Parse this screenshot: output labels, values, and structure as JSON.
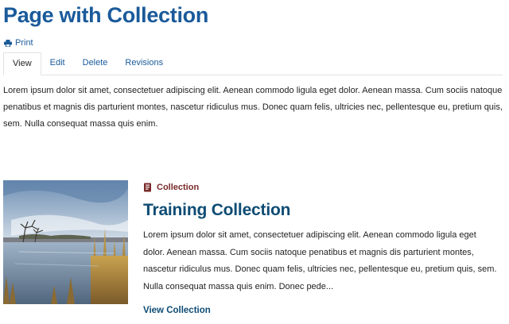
{
  "page": {
    "title": "Page with Collection",
    "print_label": "Print"
  },
  "tabs": [
    {
      "label": "View",
      "active": true
    },
    {
      "label": "Edit",
      "active": false
    },
    {
      "label": "Delete",
      "active": false
    },
    {
      "label": "Revisions",
      "active": false
    }
  ],
  "intro_text": "Lorem ipsum dolor sit amet, consectetuer adipiscing elit. Aenean commodo ligula eget dolor. Aenean massa. Cum sociis natoque penatibus et magnis dis parturient montes, nascetur ridiculus mus. Donec quam felis, ultricies nec, pellentesque eu, pretium quis, sem. Nulla consequat massa quis enim.",
  "teaser": {
    "type_label": "Collection",
    "title": "Training Collection",
    "body": "Lorem ipsum dolor sit amet, consectetuer adipiscing elit. Aenean commodo ligula eget dolor. Aenean massa. Cum sociis natoque penatibus et magnis dis parturient montes, nascetur ridiculus mus. Donec quam felis, ultricies nec, pellentesque eu, pretium quis, sem. Nulla consequat massa quis enim. Donec pede...",
    "link_label": "View Collection",
    "image_icon": "landscape-photo"
  },
  "colors": {
    "link_blue": "#1a5a9a",
    "title_dark_blue": "#0e4c74",
    "collection_red": "#7a2929"
  }
}
